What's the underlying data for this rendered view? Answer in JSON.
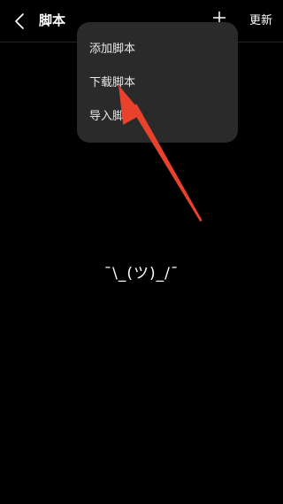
{
  "header": {
    "back_icon": "chevron-left-icon",
    "title": "脚本",
    "add_icon": "plus-icon",
    "update_label": "更新"
  },
  "dropdown": {
    "items": [
      {
        "label": "添加脚本"
      },
      {
        "label": "下载脚本"
      },
      {
        "label": "导入脚本"
      }
    ]
  },
  "empty_state": {
    "text": "¯\\_(ツ)_/¯"
  },
  "colors": {
    "background": "#000000",
    "menu_background": "#2a2a2a",
    "text": "#ffffff",
    "annotation_arrow": "#e8412c"
  }
}
